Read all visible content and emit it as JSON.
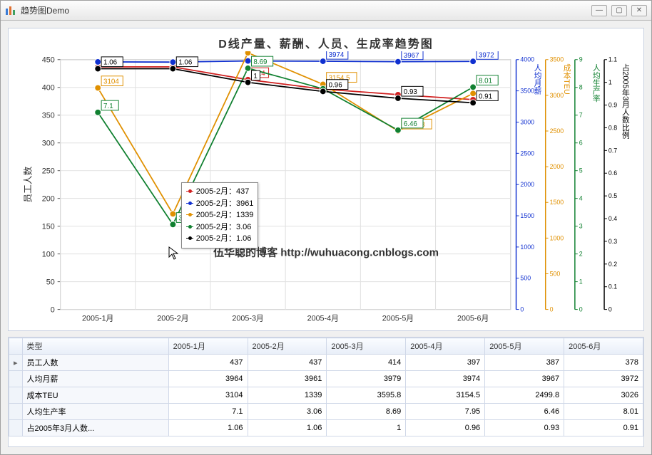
{
  "window": {
    "title": "趋势图Demo"
  },
  "chart_data": {
    "type": "line",
    "title": "D线产量、薪酬、人员、生成率趋势图",
    "categories": [
      "2005-1月",
      "2005-2月",
      "2005-3月",
      "2005-4月",
      "2005-5月",
      "2005-6月"
    ],
    "primary_axis": {
      "label": "员工人数",
      "min": 0,
      "max": 450,
      "ticks": [
        0,
        50,
        100,
        150,
        200,
        250,
        300,
        350,
        400,
        450
      ]
    },
    "right_axes": [
      {
        "label": "人均月薪",
        "min": 0,
        "max": 4000,
        "ticks": [
          0,
          500,
          1000,
          1500,
          2000,
          2500,
          3000,
          3500,
          4000
        ],
        "color": "#1030d0"
      },
      {
        "label": "成本TEU",
        "min": 0,
        "max": 3500,
        "ticks": [
          0,
          500,
          1000,
          1500,
          2000,
          2500,
          3000,
          3500
        ],
        "color": "#e09000"
      },
      {
        "label": "人均生产率",
        "min": 0,
        "max": 9,
        "ticks": [
          0,
          1,
          2,
          3,
          4,
          5,
          6,
          7,
          8,
          9
        ],
        "color": "#108030"
      },
      {
        "label": "占2005年3月人数比例",
        "min": 0,
        "max": 1.1,
        "ticks": [
          0,
          0.1,
          0.2,
          0.3,
          0.4,
          0.5,
          0.6,
          0.7,
          0.8,
          0.9,
          1,
          1.1
        ],
        "color": "#000000"
      }
    ],
    "series": [
      {
        "name": "员工人数",
        "color": "#d02020",
        "values": [
          437,
          437,
          414,
          397,
          387,
          378
        ],
        "labels": [
          "",
          "",
          "414",
          "",
          "",
          ""
        ]
      },
      {
        "name": "人均月薪",
        "color": "#1030d0",
        "values": [
          3964,
          3961,
          3979,
          3974,
          3967,
          3972
        ],
        "labels": [
          "",
          "",
          "",
          "3974",
          "3967",
          "3972"
        ]
      },
      {
        "name": "成本TEU",
        "color": "#e09000",
        "values": [
          3104,
          1339,
          3595.8,
          3154.5,
          2499.8,
          3026
        ],
        "labels": [
          "3104",
          "",
          "3595.8",
          "3154.5",
          "2499.8",
          ""
        ]
      },
      {
        "name": "人均生产率",
        "color": "#108030",
        "values": [
          7.1,
          3.06,
          8.69,
          7.95,
          6.46,
          8.01
        ],
        "labels": [
          "7.1",
          "3.06",
          "8.69",
          "",
          "6.46",
          "8.01"
        ]
      },
      {
        "name": "占2005年3月人数比例",
        "color": "#000000",
        "values": [
          1.06,
          1.06,
          1,
          0.96,
          0.93,
          0.91
        ],
        "labels": [
          "1.06",
          "1.06",
          "1",
          "0.96",
          "0.93",
          "0.91"
        ]
      }
    ],
    "tooltip": {
      "x_index": 1,
      "rows": [
        {
          "color": "#d02020",
          "text": "2005-2月：437"
        },
        {
          "color": "#1030d0",
          "text": "2005-2月：3961"
        },
        {
          "color": "#e09000",
          "text": "2005-2月：1339"
        },
        {
          "color": "#108030",
          "text": "2005-2月：3.06"
        },
        {
          "color": "#000000",
          "text": "2005-2月：1.06"
        }
      ]
    },
    "watermark": "伍华聪的博客 http://wuhuacong.cnblogs.com"
  },
  "grid": {
    "type_header": "类型",
    "columns": [
      "2005-1月",
      "2005-2月",
      "2005-3月",
      "2005-4月",
      "2005-5月",
      "2005-6月"
    ],
    "rows": [
      {
        "name": "员工人数",
        "values": [
          "437",
          "437",
          "414",
          "397",
          "387",
          "378"
        ]
      },
      {
        "name": "人均月薪",
        "values": [
          "3964",
          "3961",
          "3979",
          "3974",
          "3967",
          "3972"
        ]
      },
      {
        "name": "成本TEU",
        "values": [
          "3104",
          "1339",
          "3595.8",
          "3154.5",
          "2499.8",
          "3026"
        ]
      },
      {
        "name": "人均生产率",
        "values": [
          "7.1",
          "3.06",
          "8.69",
          "7.95",
          "6.46",
          "8.01"
        ]
      },
      {
        "name": "占2005年3月人数...",
        "values": [
          "1.06",
          "1.06",
          "1",
          "0.96",
          "0.93",
          "0.91"
        ]
      }
    ]
  }
}
